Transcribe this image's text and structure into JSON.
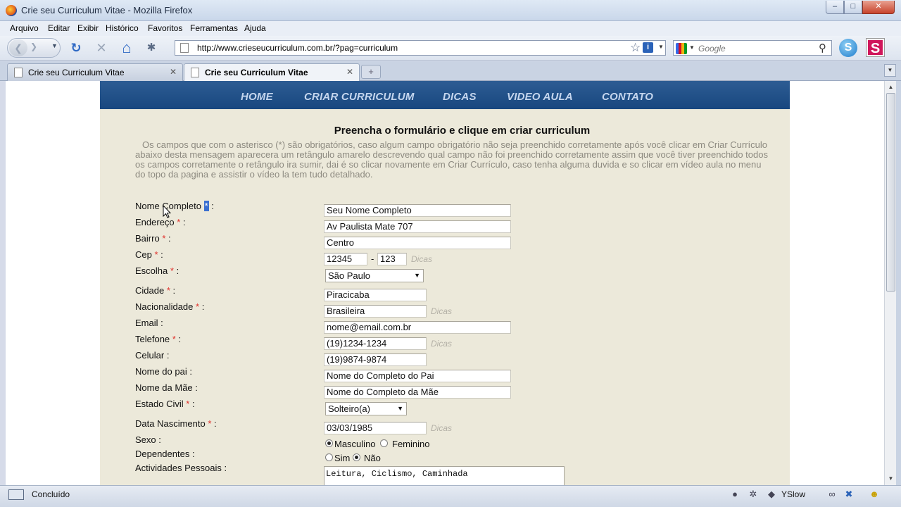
{
  "window": {
    "title": "Crie seu Curriculum Vitae - Mozilla Firefox",
    "min_glyph": "–",
    "max_glyph": "□",
    "close_glyph": "✕"
  },
  "menu": [
    "Arquivo",
    "Editar",
    "Exibir",
    "Histórico",
    "Favoritos",
    "Ferramentas",
    "Ajuda"
  ],
  "toolbar": {
    "back_glyph": "❮",
    "forward_glyph": "❯",
    "dropdown_glyph": "▼",
    "reload_glyph": "↻",
    "stop_glyph": "✕",
    "home_glyph": "⌂",
    "addon_glyph": "✱",
    "url": "http://www.crieseucurriculum.com.br/?pag=curriculum",
    "star_glyph": "☆",
    "info_glyph": "i",
    "search_placeholder": "Google",
    "search_glyph": "⚲",
    "skype_glyph": "S",
    "ext_glyph": "S"
  },
  "tabs": [
    {
      "label": "Crie seu Curriculum Vitae",
      "active": false
    },
    {
      "label": "Crie seu Curriculum Vitae",
      "active": true
    }
  ],
  "tab_close_glyph": "✕",
  "newtab_glyph": "+",
  "site": {
    "nav": [
      "HOME",
      "CRIAR CURRICULUM",
      "DICAS",
      "VIDEO AULA",
      "CONTATO"
    ],
    "form_title": "Preencha o formulário e clique em criar curriculum",
    "intro": "Os campos que com o asterisco (*) são obrigatórios, caso algum campo obrigatório não seja preenchido corretamente após você clicar em Criar Currículo abaixo desta mensagem aparecera um retângulo amarelo descrevendo qual campo não foi preenchido corretamente assim que você tiver preenchido todos os campos corretamente o retângulo ira sumir, dai é so clicar novamente em Criar Currículo, caso tenha alguma duvida e so clicar em vídeo aula no menu do topo da pagina e assistir o vídeo la tem tudo detalhado.",
    "asterisk": "*",
    "colon": ":",
    "hint": "Dicas",
    "fields": {
      "nome": {
        "label": "Nome Completo",
        "value": "Seu Nome Completo"
      },
      "endereco": {
        "label": "Endereço",
        "value": "Av Paulista Mate 707"
      },
      "bairro": {
        "label": "Bairro",
        "value": "Centro"
      },
      "cep": {
        "label": "Cep",
        "value1": "12345",
        "value2": "123",
        "sep": "-"
      },
      "escolha": {
        "label": "Escolha",
        "value": "São Paulo"
      },
      "cidade": {
        "label": "Cidade",
        "value": "Piracicaba"
      },
      "nacionalidade": {
        "label": "Nacionalidade",
        "value": "Brasileira"
      },
      "email": {
        "label": "Email",
        "value": "nome@email.com.br"
      },
      "telefone": {
        "label": "Telefone",
        "value": "(19)1234-1234"
      },
      "celular": {
        "label": "Celular",
        "value": "(19)9874-9874"
      },
      "pai": {
        "label": "Nome do pai",
        "value": "Nome do Completo do Pai"
      },
      "mae": {
        "label": "Nome da Mãe",
        "value": "Nome do Completo da Mãe"
      },
      "estado_civil": {
        "label": "Estado Civil",
        "value": "Solteiro(a)"
      },
      "nascimento": {
        "label": "Data Nascimento",
        "value": "03/03/1985"
      },
      "sexo": {
        "label": "Sexo",
        "options": [
          "Masculino",
          "Feminino"
        ],
        "selected": "Masculino"
      },
      "dependentes": {
        "label": "Dependentes",
        "options": [
          "Sim",
          "Não"
        ],
        "selected": "Não"
      },
      "atividades": {
        "label": "Actividades Pessoais",
        "value": "Leitura, Ciclismo, Caminhada"
      }
    }
  },
  "status": {
    "text": "Concluído",
    "yslow": "YSlow"
  },
  "scroll": {
    "up_glyph": "▲",
    "down_glyph": "▼"
  }
}
